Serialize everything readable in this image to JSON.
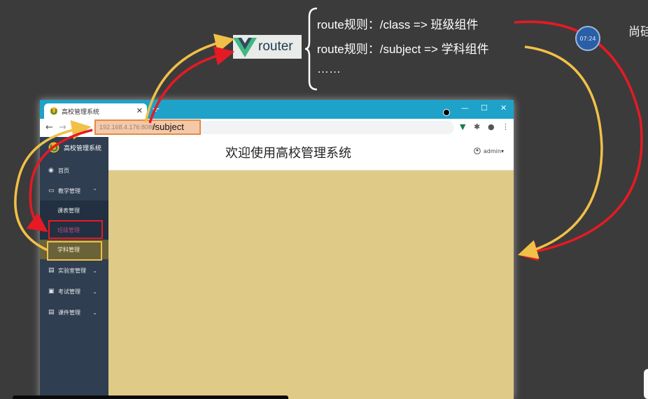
{
  "slide": {
    "route_lines": [
      "route规则：/class =>  班级组件",
      "route规则：/subject => 学科组件",
      "……"
    ],
    "logo_text": "router",
    "side_text": "尚硅",
    "timer": "07:24"
  },
  "browser": {
    "tab_title": "高校管理系统",
    "url_host": "192.168.4.176:8080",
    "url_path": "/subject"
  },
  "app": {
    "brand_title": "高校管理系统",
    "header_title": "欢迎使用高校管理系统",
    "user": "admin",
    "menu": [
      {
        "label": "首页",
        "icon": "dashboard-icon"
      },
      {
        "label": "教学管理",
        "icon": "monitor-icon",
        "expanded": true
      },
      {
        "label": "课表管理",
        "sub": true
      },
      {
        "label": "班级管理",
        "sub": true
      },
      {
        "label": "学科管理",
        "sub": true
      },
      {
        "label": "实验室管理",
        "icon": "document-icon"
      },
      {
        "label": "考试管理",
        "icon": "briefcase-icon"
      },
      {
        "label": "课件管理",
        "icon": "document-icon"
      }
    ]
  },
  "colors": {
    "accent_red": "#e51a24",
    "accent_yellow": "#f0c048",
    "url_highlight": "#e58a45",
    "sidebar": "#2f3e50",
    "content": "#e0ca87",
    "titlebar": "#1ea2c9"
  }
}
